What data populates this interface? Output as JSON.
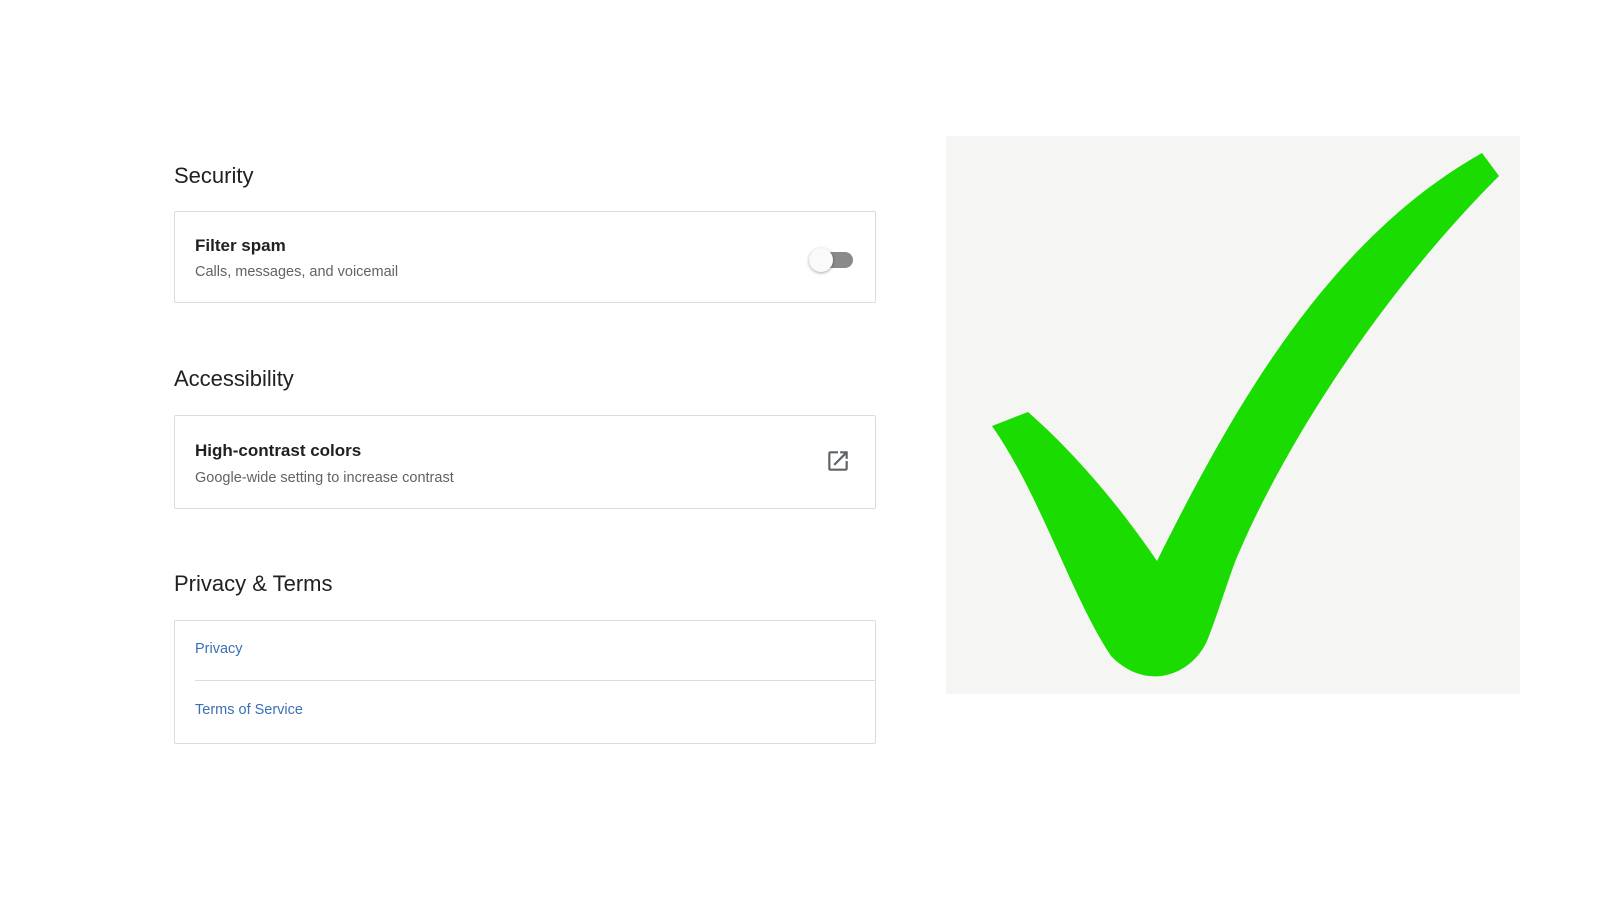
{
  "security": {
    "heading": "Security",
    "filter_spam": {
      "title": "Filter spam",
      "subtitle": "Calls, messages, and voicemail",
      "enabled": false
    }
  },
  "accessibility": {
    "heading": "Accessibility",
    "high_contrast": {
      "title": "High-contrast colors",
      "subtitle": "Google-wide setting to increase contrast",
      "icon": "open-in-new-icon"
    }
  },
  "privacy_terms": {
    "heading": "Privacy & Terms",
    "links": [
      "Privacy",
      "Terms of Service"
    ]
  },
  "overlay": {
    "icon": "checkmark-icon",
    "check_color": "#1adc00",
    "panel_color": "#f5f5f4"
  }
}
